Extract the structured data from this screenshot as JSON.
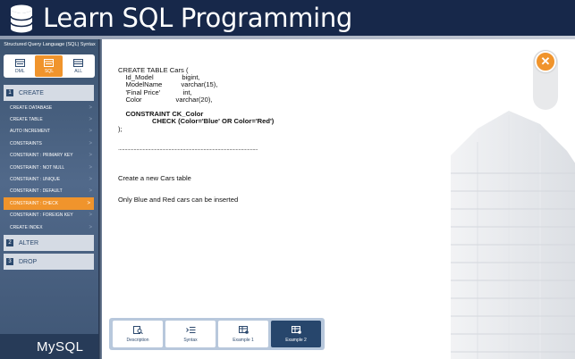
{
  "header": {
    "title": "Learn SQL Programming"
  },
  "sidebar": {
    "caption": "Structured Query Language (SQL) Syntax",
    "type_tabs": [
      {
        "label": "DML",
        "icon": "dml-icon",
        "active": false
      },
      {
        "label": "SQL",
        "icon": "sql-icon",
        "active": true
      },
      {
        "label": "ALL",
        "icon": "all-icon",
        "active": false
      }
    ],
    "sections": [
      {
        "num": "1",
        "label": "CREATE"
      },
      {
        "num": "2",
        "label": "ALTER"
      },
      {
        "num": "3",
        "label": "DROP"
      }
    ],
    "items": [
      {
        "label": "CREATE DATABASE"
      },
      {
        "label": "CREATE TABLE"
      },
      {
        "label": "AUTO INCREMENT"
      },
      {
        "label": "CONSTRAINTS"
      },
      {
        "label": "CONSTRAINT : PRIMARY KEY"
      },
      {
        "label": "CONSTRAINT : NOT NULL"
      },
      {
        "label": "CONSTRAINT : UNIQUE"
      },
      {
        "label": "CONSTRAINT : DEFAULT"
      },
      {
        "label": "CONSTRAINT : CHECK",
        "active": true
      },
      {
        "label": "CONSTRAINT : FOREIGN KEY"
      },
      {
        "label": "CREATE INDEX"
      }
    ],
    "chevron": ">",
    "brand": "MySQL"
  },
  "main": {
    "code_lines": [
      {
        "text": "CREATE TABLE Cars (",
        "bold": false
      },
      {
        "text": "    Id_Model               bigint,",
        "bold": false
      },
      {
        "text": "    ModelName          varchar(15),",
        "bold": false
      },
      {
        "text": "    'Final Price'            int,",
        "bold": false
      },
      {
        "text": "    Color                  varchar(20),",
        "bold": false
      },
      {
        "text": "",
        "bold": false
      },
      {
        "text": "    CONSTRAINT CK_Color",
        "bold": true
      },
      {
        "text": "                  CHECK (Color='Blue' OR Color='Red')",
        "bold": true
      },
      {
        "text": ");",
        "bold": false
      }
    ],
    "separator": "............................................................................................................",
    "description_1": "Create a new Cars table",
    "description_2": "Only Blue and Red cars can be inserted",
    "close_symbol": "✕",
    "bottom_tabs": [
      {
        "label": "Description",
        "icon": "search-document-icon",
        "active": false
      },
      {
        "label": "Syntax",
        "icon": "syntax-list-icon",
        "active": false
      },
      {
        "label": "Example 1",
        "icon": "example-table-icon",
        "active": false
      },
      {
        "label": "Example 2",
        "icon": "example-table-icon",
        "active": true
      }
    ]
  },
  "colors": {
    "header_bg": "#17284a",
    "accent": "#f0942c",
    "sidebar_bg": "#51698a",
    "active_tab_bg": "#27466c"
  }
}
